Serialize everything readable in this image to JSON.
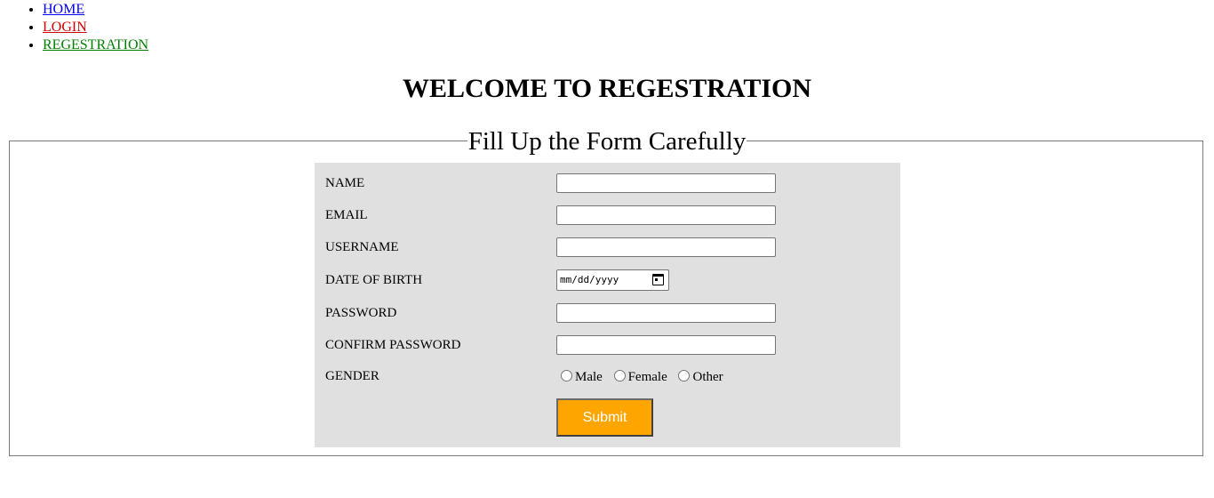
{
  "nav": {
    "items": [
      {
        "label": "HOME"
      },
      {
        "label": "LOGIN"
      },
      {
        "label": "REGESTRATION"
      }
    ]
  },
  "page": {
    "title": "WELCOME TO REGESTRATION"
  },
  "form": {
    "legend": "Fill Up the Form Carefully",
    "name_label": "NAME",
    "name_value": "",
    "email_label": "EMAIL",
    "email_value": "",
    "username_label": "USERNAME",
    "username_value": "",
    "dob_label": "DATE OF BIRTH",
    "dob_placeholder": "mm/dd/yyyy",
    "password_label": "PASSWORD",
    "password_value": "",
    "confirm_label": "CONFIRM PASSWORD",
    "confirm_value": "",
    "gender_label": "GENDER",
    "gender_options": [
      "Male",
      "Female",
      "Other"
    ],
    "submit_label": "Submit"
  },
  "colors": {
    "home_link": "#0000ee",
    "login_link": "#d00000",
    "registration_link": "#008000",
    "panel_bg": "#e0e0e0",
    "submit_bg": "#ffa500"
  },
  "icons": {
    "date_picker": "calendar-icon",
    "nav_bullet": "bullet-icon"
  }
}
